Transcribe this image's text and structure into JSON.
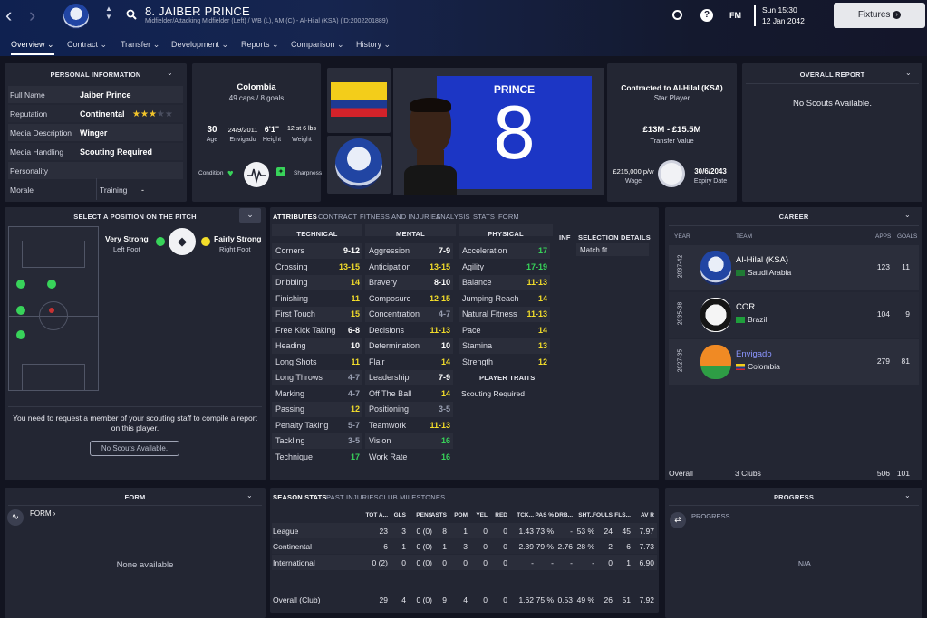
{
  "header": {
    "title": "8. JAIBER PRINCE",
    "subtitle": "Midfielder/Attacking Midfielder (Left) / WB (L), AM (C) - Al-Hilal (KSA) (ID:2002201889)",
    "clock_time": "Sun 15:30",
    "clock_date": "12 Jan 2042",
    "fm_label": "FM",
    "fixtures_label": "Fixtures"
  },
  "nav": {
    "overview": "Overview",
    "contract": "Contract",
    "transfer": "Transfer",
    "development": "Development",
    "reports": "Reports",
    "comparison": "Comparison",
    "history": "History"
  },
  "personal": {
    "header": "PERSONAL INFORMATION",
    "rows": [
      {
        "label": "Full Name",
        "value": "Jaiber Prince"
      },
      {
        "label": "Reputation",
        "value": "Continental"
      },
      {
        "label": "Media Description",
        "value": "Winger"
      },
      {
        "label": "Media Handling",
        "value": "Scouting Required"
      },
      {
        "label": "Personality",
        "value": ""
      },
      {
        "label": "Morale",
        "value": ""
      }
    ],
    "training_label": "Training",
    "training_value": "-",
    "reputation_stars": 3,
    "reputation_stars_max": 5
  },
  "profile": {
    "nation": "Colombia",
    "caps": "49 caps / 8 goals",
    "age_value": "30",
    "age_label": "Age",
    "dob_value": "24/9/2011",
    "dob_label": "Envigado",
    "height_value": "6'1\"",
    "height_label": "Height",
    "weight_value": "12 st 6 lbs",
    "weight_label": "Weight",
    "condition_label": "Condition",
    "sharpness_label": "Sharpness",
    "shirt_name": "PRINCE",
    "shirt_number": "8"
  },
  "contract": {
    "club": "Contracted to Al-Hilal (KSA)",
    "status": "Star Player",
    "value": "£13M - £15.5M",
    "value_label": "Transfer Value",
    "wage": "£215,000 p/w",
    "wage_label": "Wage",
    "expiry": "30/6/2043",
    "expiry_label": "Expiry Date"
  },
  "overall_report": {
    "header": "OVERALL REPORT",
    "text": "No Scouts Available."
  },
  "position": {
    "header": "SELECT A POSITION ON THE PITCH",
    "left_foot_value": "Very Strong",
    "left_foot_label": "Left Foot",
    "right_foot_value": "Fairly Strong",
    "right_foot_label": "Right Foot",
    "scout_text": "You need to request a member of your scouting staff to compile a report on this player.",
    "no_scouts_button": "No Scouts Available."
  },
  "attr_tabs": [
    "ATTRIBUTES",
    "CONTRACT",
    "FITNESS AND INJURIES",
    "ANALYSIS",
    "STATS",
    "FORM"
  ],
  "attributes": {
    "technical_header": "TECHNICAL",
    "mental_header": "MENTAL",
    "physical_header": "PHYSICAL",
    "inf_header": "INF",
    "selection_header": "SELECTION DETAILS",
    "selection_value": "Match fit",
    "traits_header": "PLAYER TRAITS",
    "traits_value": "Scouting Required",
    "technical": [
      {
        "name": "Corners",
        "value": "9-12",
        "tier": "w"
      },
      {
        "name": "Crossing",
        "value": "13-15",
        "tier": "y"
      },
      {
        "name": "Dribbling",
        "value": "14",
        "tier": "y"
      },
      {
        "name": "Finishing",
        "value": "11",
        "tier": "y"
      },
      {
        "name": "First Touch",
        "value": "15",
        "tier": "y"
      },
      {
        "name": "Free Kick Taking",
        "value": "6-8",
        "tier": "w"
      },
      {
        "name": "Heading",
        "value": "10",
        "tier": "w"
      },
      {
        "name": "Long Shots",
        "value": "11",
        "tier": "y"
      },
      {
        "name": "Long Throws",
        "value": "4-7",
        "tier": "gr"
      },
      {
        "name": "Marking",
        "value": "4-7",
        "tier": "gr"
      },
      {
        "name": "Passing",
        "value": "12",
        "tier": "y"
      },
      {
        "name": "Penalty Taking",
        "value": "5-7",
        "tier": "gr"
      },
      {
        "name": "Tackling",
        "value": "3-5",
        "tier": "gr"
      },
      {
        "name": "Technique",
        "value": "17",
        "tier": "g"
      }
    ],
    "mental": [
      {
        "name": "Aggression",
        "value": "7-9",
        "tier": "w"
      },
      {
        "name": "Anticipation",
        "value": "13-15",
        "tier": "y"
      },
      {
        "name": "Bravery",
        "value": "8-10",
        "tier": "w"
      },
      {
        "name": "Composure",
        "value": "12-15",
        "tier": "y"
      },
      {
        "name": "Concentration",
        "value": "4-7",
        "tier": "gr"
      },
      {
        "name": "Decisions",
        "value": "11-13",
        "tier": "y"
      },
      {
        "name": "Determination",
        "value": "10",
        "tier": "w"
      },
      {
        "name": "Flair",
        "value": "14",
        "tier": "y"
      },
      {
        "name": "Leadership",
        "value": "7-9",
        "tier": "w"
      },
      {
        "name": "Off The Ball",
        "value": "14",
        "tier": "y"
      },
      {
        "name": "Positioning",
        "value": "3-5",
        "tier": "gr"
      },
      {
        "name": "Teamwork",
        "value": "11-13",
        "tier": "y"
      },
      {
        "name": "Vision",
        "value": "16",
        "tier": "g"
      },
      {
        "name": "Work Rate",
        "value": "16",
        "tier": "g"
      }
    ],
    "physical": [
      {
        "name": "Acceleration",
        "value": "17",
        "tier": "g"
      },
      {
        "name": "Agility",
        "value": "17-19",
        "tier": "g"
      },
      {
        "name": "Balance",
        "value": "11-13",
        "tier": "y"
      },
      {
        "name": "Jumping Reach",
        "value": "14",
        "tier": "y"
      },
      {
        "name": "Natural Fitness",
        "value": "11-13",
        "tier": "y"
      },
      {
        "name": "Pace",
        "value": "14",
        "tier": "y"
      },
      {
        "name": "Stamina",
        "value": "13",
        "tier": "y"
      },
      {
        "name": "Strength",
        "value": "12",
        "tier": "y"
      }
    ]
  },
  "career": {
    "header": "CAREER",
    "col_year": "YEAR",
    "col_team": "TEAM",
    "col_apps": "APPS",
    "col_goals": "GOALS",
    "rows": [
      {
        "years": "2037-42",
        "team": "Al-Hilal (KSA)",
        "nation": "Saudi Arabia",
        "apps": "123",
        "goals": "11"
      },
      {
        "years": "2035-38",
        "team": "COR",
        "nation": "Brazil",
        "apps": "104",
        "goals": "9"
      },
      {
        "years": "2027-35",
        "team": "Envigado",
        "nation": "Colombia",
        "apps": "279",
        "goals": "81"
      }
    ],
    "overall_label": "Overall",
    "overall_clubs": "3 Clubs",
    "overall_apps": "506",
    "overall_goals": "101"
  },
  "form": {
    "header": "FORM",
    "link": "FORM",
    "empty": "None available"
  },
  "season_tabs": [
    "SEASON STATS",
    "PAST INJURIES",
    "CLUB MILESTONES"
  ],
  "season": {
    "columns": [
      "TOT A...",
      "GLS",
      "PENS",
      "ASTS",
      "POM",
      "YEL",
      "RED",
      "TCK...",
      "PAS %",
      "DRB...",
      "SHT...",
      "FOULS",
      "FLS...",
      "AV R"
    ],
    "rows": [
      {
        "name": "League",
        "cells": [
          "23",
          "3",
          "0 (0)",
          "8",
          "1",
          "0",
          "0",
          "1.43",
          "73 %",
          "-",
          "53 %",
          "24",
          "45",
          "7.97"
        ]
      },
      {
        "name": "Continental",
        "cells": [
          "6",
          "1",
          "0 (0)",
          "1",
          "3",
          "0",
          "0",
          "2.39",
          "79 %",
          "2.76",
          "28 %",
          "2",
          "6",
          "7.73"
        ]
      },
      {
        "name": "International",
        "cells": [
          "0 (2)",
          "0",
          "0 (0)",
          "0",
          "0",
          "0",
          "0",
          "-",
          "-",
          "-",
          "-",
          "0",
          "1",
          "6.90"
        ]
      },
      {
        "name": "Overall (Club)",
        "cells": [
          "29",
          "4",
          "0 (0)",
          "9",
          "4",
          "0",
          "0",
          "1.62",
          "75 %",
          "0.53",
          "49 %",
          "26",
          "51",
          "7.92"
        ]
      }
    ]
  },
  "progress": {
    "header": "PROGRESS",
    "link": "PROGRESS",
    "value": "N/A"
  }
}
